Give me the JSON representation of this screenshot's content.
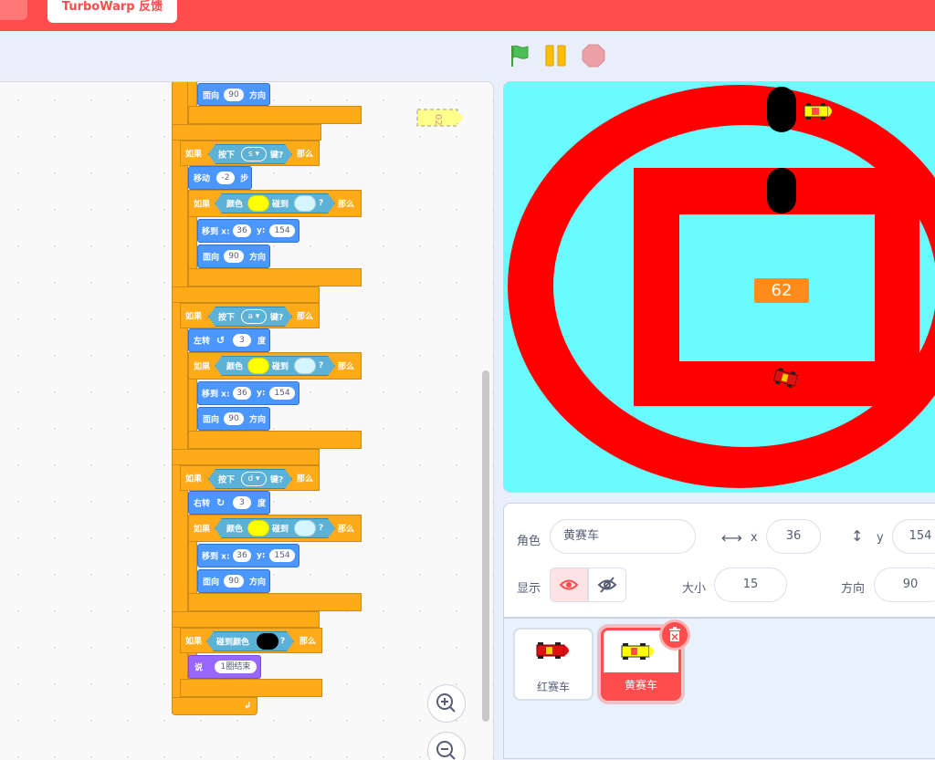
{
  "topbar": {
    "feedback_label": "TurboWarp 反馈"
  },
  "controls": {
    "green_flag": "green-flag-icon",
    "pause": "pause-icon",
    "stop": "stop-icon"
  },
  "blocks": {
    "face_direction": "面向",
    "direction_word": "方向",
    "direction_value": "90",
    "if_word": "如果",
    "then_word": "那么",
    "key_pressed_prefix": "按下",
    "key_pressed_suffix": "键?",
    "key_s": "s",
    "key_a": "a",
    "key_d": "d",
    "move_word": "移动",
    "move_value": "-2",
    "steps_word": "步",
    "color_word": "颜色",
    "touching_word": "碰到",
    "question": "?",
    "goto_x": "移到 x:",
    "goto_y": "y:",
    "x_value": "36",
    "y_value": "154",
    "turn_left": "左转",
    "turn_right": "右转",
    "turn_value": "3",
    "degrees_word": "度",
    "touch_color_word": "碰到颜色",
    "say_word": "说",
    "say_value": "1圈结束",
    "yellow": "#ffff00",
    "light_cyan": "#d4f7ff",
    "black": "#000000"
  },
  "stage": {
    "monitor_value": "62"
  },
  "sprite_info": {
    "sprite_label": "角色",
    "sprite_name": "黄赛车",
    "x_label": "x",
    "x_value": "36",
    "y_label": "y",
    "y_value": "154",
    "show_label": "显示",
    "size_label": "大小",
    "size_value": "15",
    "direction_label": "方向",
    "direction_value": "90"
  },
  "sprites": [
    {
      "name": "红赛车",
      "selected": false
    },
    {
      "name": "黄赛车",
      "selected": true
    }
  ],
  "colors": {
    "accent": "#ff4c4c",
    "stage_bg": "#6afbff",
    "track": "#ff0000",
    "control": "#ffab19",
    "motion": "#4c97ff",
    "sensing": "#5cb1d6",
    "looks": "#9966ff"
  }
}
